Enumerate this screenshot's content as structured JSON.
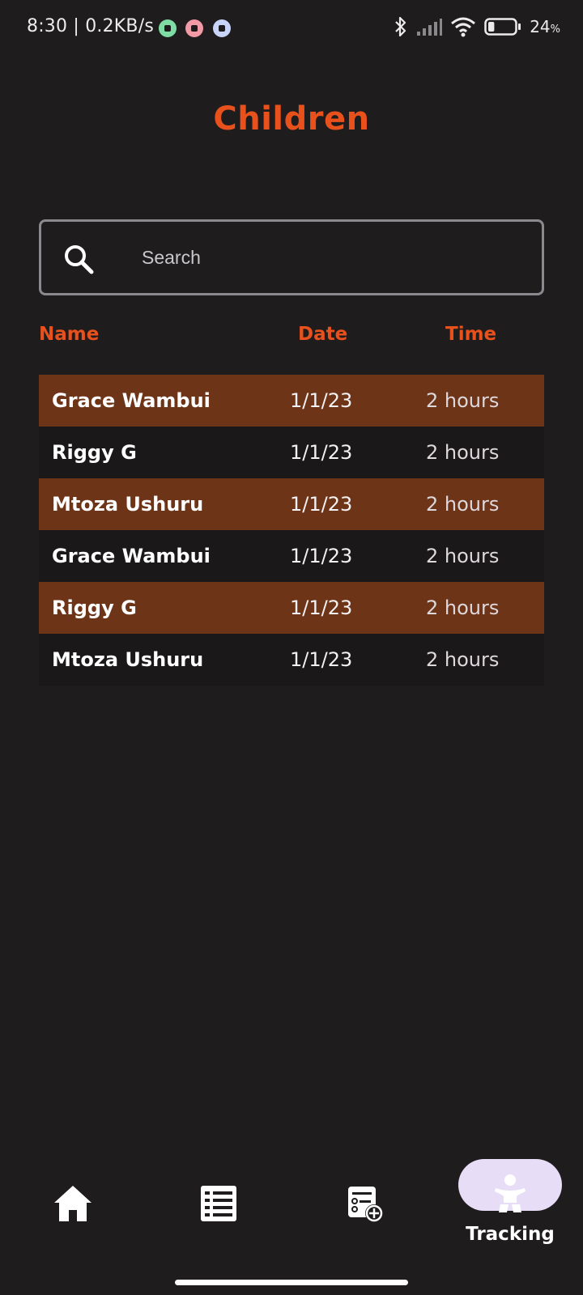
{
  "status_bar": {
    "time_speed": "8:30 | 0.2KB/s",
    "battery_value": "24",
    "battery_unit": "%",
    "battery_level": 0.24,
    "icons": [
      "whatsapp-icon",
      "gmail-icon",
      "lock-notification-icon",
      "bluetooth-icon",
      "signal-icon",
      "wifi-icon",
      "battery-icon"
    ]
  },
  "header": {
    "title": "Children"
  },
  "search": {
    "placeholder": "Search",
    "value": "",
    "icon": "search-icon"
  },
  "table": {
    "columns": [
      "Name",
      "Date",
      "Time"
    ],
    "rows": [
      {
        "name": "Grace Wambui",
        "date": "1/1/23",
        "time": "2 hours"
      },
      {
        "name": "Riggy G",
        "date": "1/1/23",
        "time": "2 hours"
      },
      {
        "name": "Mtoza Ushuru",
        "date": "1/1/23",
        "time": "2 hours"
      },
      {
        "name": "Grace Wambui",
        "date": "1/1/23",
        "time": "2 hours"
      },
      {
        "name": "Riggy G",
        "date": "1/1/23",
        "time": "2 hours"
      },
      {
        "name": "Mtoza Ushuru",
        "date": "1/1/23",
        "time": "2 hours"
      }
    ]
  },
  "bottom_nav": {
    "items": [
      {
        "icon": "home-icon"
      },
      {
        "icon": "list-icon"
      },
      {
        "icon": "add-record-icon"
      },
      {
        "icon": "baby-icon",
        "label": "Tracking",
        "active": true
      }
    ]
  },
  "colors": {
    "accent": "#e8511c",
    "background": "#1e1c1d",
    "row_highlight": "#6e3417",
    "active_pill": "#e8ddf6"
  }
}
